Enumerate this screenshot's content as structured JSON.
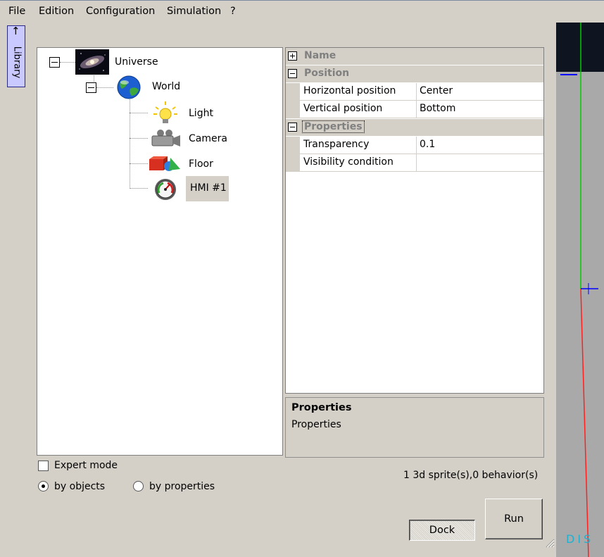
{
  "menu": [
    "File",
    "Edition",
    "Configuration",
    "Simulation",
    "?"
  ],
  "library_tab": {
    "arrow": "↑",
    "label": "Library"
  },
  "tree": {
    "universe": {
      "label": "Universe",
      "icon": "galaxy-icon"
    },
    "world": {
      "label": "World",
      "icon": "globe-icon"
    },
    "children": [
      {
        "label": "Light",
        "icon": "lightbulb-icon"
      },
      {
        "label": "Camera",
        "icon": "camera-icon"
      },
      {
        "label": "Floor",
        "icon": "floor-shapes-icon"
      },
      {
        "label": "HMI #1",
        "icon": "gauge-icon",
        "selected": true
      }
    ]
  },
  "properties": {
    "categories": [
      {
        "label": "Name",
        "state": "collapsed"
      },
      {
        "label": "Position",
        "state": "expanded",
        "rows": [
          {
            "name": "Horizontal position",
            "value": "Center"
          },
          {
            "name": "Vertical position",
            "value": "Bottom"
          }
        ]
      },
      {
        "label": "Properties",
        "state": "expanded",
        "focused": true,
        "rows": [
          {
            "name": "Transparency",
            "value": "0.1"
          },
          {
            "name": "Visibility condition",
            "value": ""
          }
        ]
      }
    ]
  },
  "description": {
    "title": "Properties",
    "text": "Properties"
  },
  "controls": {
    "expert_mode": {
      "label": "Expert mode",
      "checked": false
    },
    "view_mode": {
      "options": [
        "by objects",
        "by properties"
      ],
      "selected": "by objects"
    },
    "status": "1 3d sprite(s),0 behavior(s)",
    "dock_label": "Dock",
    "run_label": "Run"
  },
  "viewport": {
    "watermark": "DIS"
  },
  "colors": {
    "window_bg": "#d4d0c8",
    "library_tab_bg": "#c9c9ff",
    "axis_green": "#00cc00",
    "axis_red": "#ff2020",
    "axis_blue": "#0000ff",
    "watermark": "#20b0d0"
  }
}
